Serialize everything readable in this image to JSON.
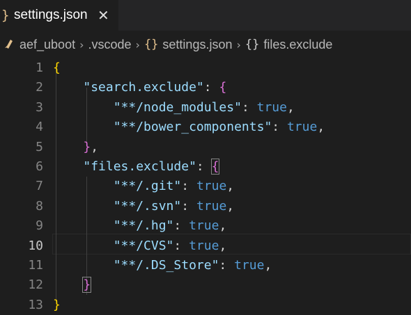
{
  "tab": {
    "icon": "}",
    "title": "settings.json",
    "close_glyph": "✕"
  },
  "breadcrumb": {
    "folder": "aef_uboot",
    "subfolder": ".vscode",
    "file_icon": "{}",
    "file": "settings.json",
    "symbol_icon": "{}",
    "symbol": "files.exclude",
    "separator": "›"
  },
  "editor": {
    "active_line": 10,
    "lines": [
      {
        "n": "1",
        "tokens": [
          {
            "t": "{",
            "c": "b1"
          }
        ]
      },
      {
        "n": "2",
        "tokens": [
          {
            "t": "    ",
            "c": "p"
          },
          {
            "t": "\"search.exclude\"",
            "c": "key"
          },
          {
            "t": ": ",
            "c": "p"
          },
          {
            "t": "{",
            "c": "b2"
          }
        ]
      },
      {
        "n": "3",
        "tokens": [
          {
            "t": "        ",
            "c": "p"
          },
          {
            "t": "\"**/node_modules\"",
            "c": "key"
          },
          {
            "t": ": ",
            "c": "p"
          },
          {
            "t": "true",
            "c": "kw"
          },
          {
            "t": ",",
            "c": "p"
          }
        ]
      },
      {
        "n": "4",
        "tokens": [
          {
            "t": "        ",
            "c": "p"
          },
          {
            "t": "\"**/bower_components\"",
            "c": "key"
          },
          {
            "t": ": ",
            "c": "p"
          },
          {
            "t": "true",
            "c": "kw"
          },
          {
            "t": ",",
            "c": "p"
          }
        ]
      },
      {
        "n": "5",
        "tokens": [
          {
            "t": "    ",
            "c": "p"
          },
          {
            "t": "}",
            "c": "b2"
          },
          {
            "t": ",",
            "c": "p"
          }
        ]
      },
      {
        "n": "6",
        "tokens": [
          {
            "t": "    ",
            "c": "p"
          },
          {
            "t": "\"files.exclude\"",
            "c": "key"
          },
          {
            "t": ": ",
            "c": "p"
          },
          {
            "t": "{",
            "c": "b2 bracket-hl"
          }
        ]
      },
      {
        "n": "7",
        "tokens": [
          {
            "t": "        ",
            "c": "p"
          },
          {
            "t": "\"**/.git\"",
            "c": "key"
          },
          {
            "t": ": ",
            "c": "p"
          },
          {
            "t": "true",
            "c": "kw"
          },
          {
            "t": ",",
            "c": "p"
          }
        ]
      },
      {
        "n": "8",
        "tokens": [
          {
            "t": "        ",
            "c": "p"
          },
          {
            "t": "\"**/.svn\"",
            "c": "key"
          },
          {
            "t": ": ",
            "c": "p"
          },
          {
            "t": "true",
            "c": "kw"
          },
          {
            "t": ",",
            "c": "p"
          }
        ]
      },
      {
        "n": "9",
        "tokens": [
          {
            "t": "        ",
            "c": "p"
          },
          {
            "t": "\"**/.hg\"",
            "c": "key"
          },
          {
            "t": ": ",
            "c": "p"
          },
          {
            "t": "true",
            "c": "kw"
          },
          {
            "t": ",",
            "c": "p"
          }
        ]
      },
      {
        "n": "10",
        "tokens": [
          {
            "t": "        ",
            "c": "p"
          },
          {
            "t": "\"**/CVS\"",
            "c": "key"
          },
          {
            "t": ": ",
            "c": "p"
          },
          {
            "t": "true",
            "c": "kw"
          },
          {
            "t": ",",
            "c": "p"
          }
        ]
      },
      {
        "n": "11",
        "tokens": [
          {
            "t": "        ",
            "c": "p"
          },
          {
            "t": "\"**/.DS_Store\"",
            "c": "key"
          },
          {
            "t": ": ",
            "c": "p"
          },
          {
            "t": "true",
            "c": "kw"
          },
          {
            "t": ",",
            "c": "p"
          }
        ]
      },
      {
        "n": "12",
        "tokens": [
          {
            "t": "    ",
            "c": "p"
          },
          {
            "t": "}",
            "c": "b2 bracket-hl"
          }
        ]
      },
      {
        "n": "13",
        "tokens": [
          {
            "t": "}",
            "c": "b1"
          }
        ]
      }
    ]
  },
  "colors": {
    "background": "#1e1e1e",
    "tab_icon": "#e2c08d",
    "key": "#9cdcfe",
    "keyword": "#569cd6",
    "bracket_level1": "#ffd700",
    "bracket_level2": "#da70d6",
    "line_number": "#858585"
  }
}
